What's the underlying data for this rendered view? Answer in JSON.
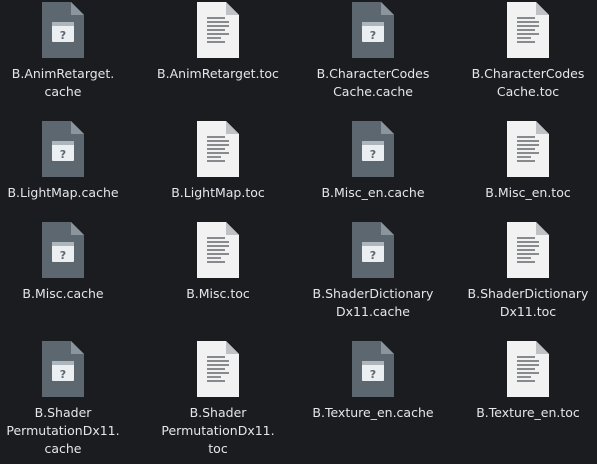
{
  "files": [
    {
      "name": "B.AnimRetarget.\ncache",
      "type": "unknown-file-icon"
    },
    {
      "name": "B.AnimRetarget.toc",
      "type": "text-file-icon"
    },
    {
      "name": "B.CharacterCodes\nCache.cache",
      "type": "unknown-file-icon"
    },
    {
      "name": "B.CharacterCodes\nCache.toc",
      "type": "text-file-icon"
    },
    {
      "name": "B.LightMap.cache",
      "type": "unknown-file-icon"
    },
    {
      "name": "B.LightMap.toc",
      "type": "text-file-icon"
    },
    {
      "name": "B.Misc_en.cache",
      "type": "unknown-file-icon"
    },
    {
      "name": "B.Misc_en.toc",
      "type": "text-file-icon"
    },
    {
      "name": "B.Misc.cache",
      "type": "unknown-file-icon"
    },
    {
      "name": "B.Misc.toc",
      "type": "text-file-icon"
    },
    {
      "name": "B.ShaderDictionary\nDx11.cache",
      "type": "unknown-file-icon"
    },
    {
      "name": "B.ShaderDictionary\nDx11.toc",
      "type": "text-file-icon"
    },
    {
      "name": "B.Shader\nPermutationDx11.\ncache",
      "type": "unknown-file-icon"
    },
    {
      "name": "B.Shader\nPermutationDx11.\ntoc",
      "type": "text-file-icon"
    },
    {
      "name": "B.Texture_en.cache",
      "type": "unknown-file-icon"
    },
    {
      "name": "B.Texture_en.toc",
      "type": "text-file-icon"
    }
  ],
  "colors": {
    "background": "#1b1c1f",
    "label": "#e4e6e9",
    "unknown_file_body": "#5d6770",
    "text_file_body": "#f2f2f2"
  }
}
